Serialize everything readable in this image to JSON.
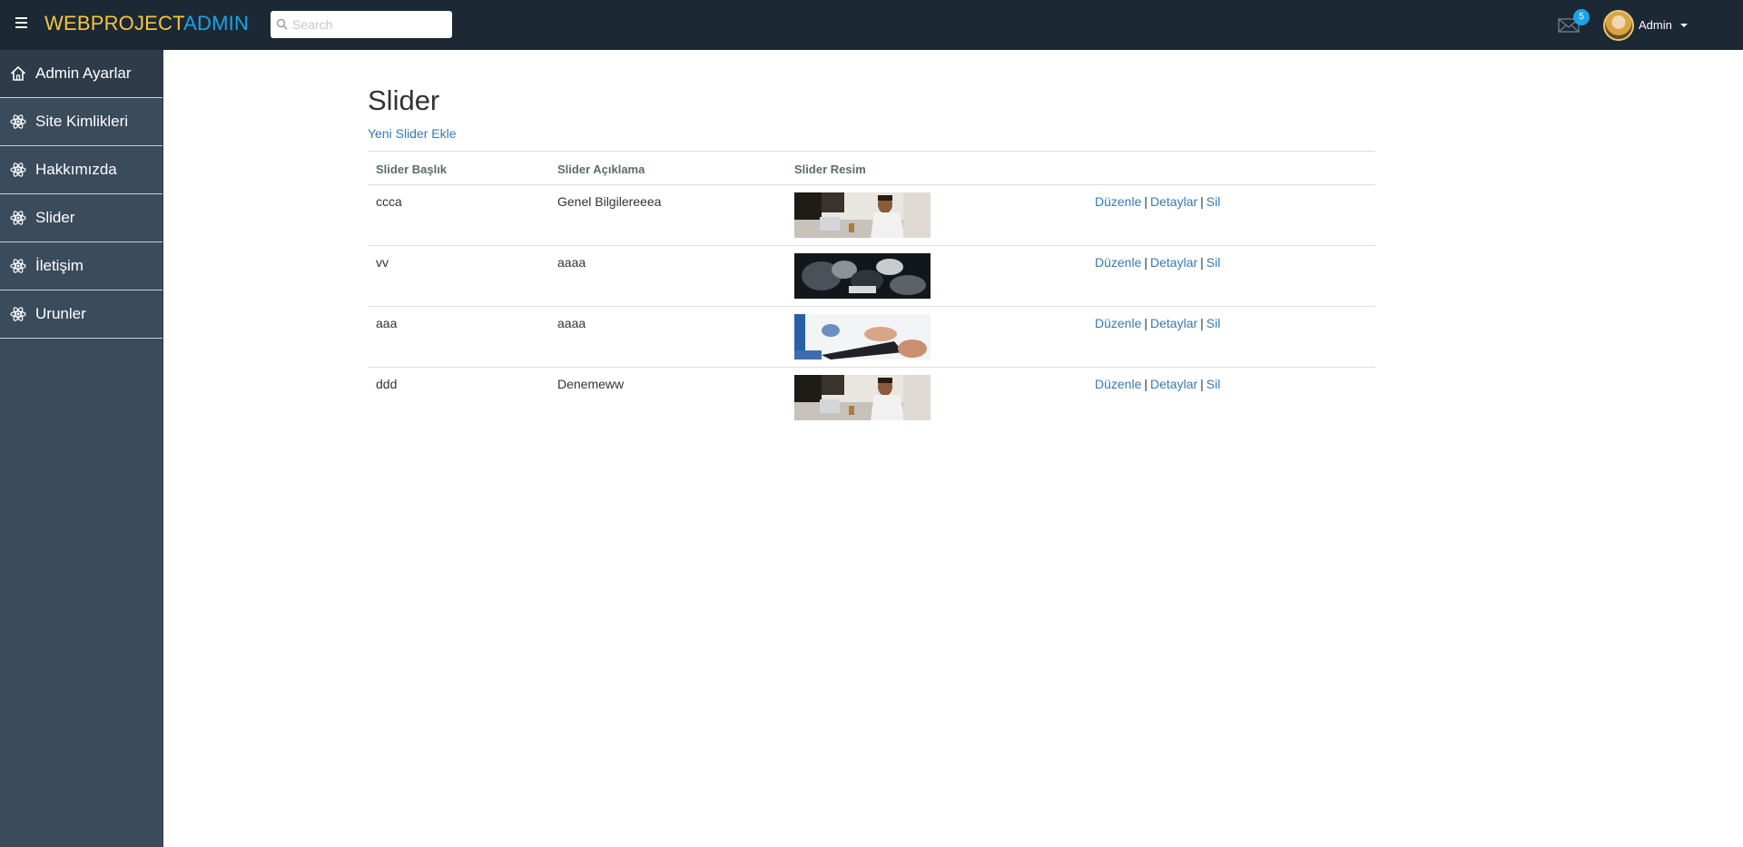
{
  "navbar": {
    "brand_part1": "WEBPROJECT",
    "brand_part2": "ADMIN",
    "search_placeholder": "Search",
    "mail_count": "5",
    "user_name": "Admin"
  },
  "sidebar": {
    "items": [
      {
        "label": "Admin Ayarlar",
        "icon": "home-icon"
      },
      {
        "label": "Site Kimlikleri",
        "icon": "atom-icon"
      },
      {
        "label": "Hakkımızda",
        "icon": "atom-icon"
      },
      {
        "label": "Slider",
        "icon": "atom-icon"
      },
      {
        "label": "İletişim",
        "icon": "atom-icon"
      },
      {
        "label": "Urunler",
        "icon": "atom-icon"
      }
    ]
  },
  "main": {
    "title": "Slider",
    "new_link": "Yeni Slider Ekle",
    "columns": [
      "Slider Başlık",
      "Slider Açıklama",
      "Slider Resim",
      ""
    ],
    "rows": [
      {
        "title": "ccca",
        "desc": "Genel Bilgilereeea",
        "image": "man-laptop-photo"
      },
      {
        "title": "vv",
        "desc": "aaaa",
        "image": "desk-dark-photo"
      },
      {
        "title": "aaa",
        "desc": "aaaa",
        "image": "hands-tablet-photo"
      },
      {
        "title": "ddd",
        "desc": "Denemeww",
        "image": "man-laptop-photo"
      }
    ],
    "actions": {
      "edit": "Düzenle",
      "details": "Detaylar",
      "delete": "Sil",
      "separator": "|"
    }
  },
  "colors": {
    "navbar_bg": "#1c2833",
    "sidebar_bg": "#3a4b5c",
    "brand_yellow": "#f5c542",
    "brand_blue": "#1ba3e8",
    "link": "#337ab7"
  }
}
